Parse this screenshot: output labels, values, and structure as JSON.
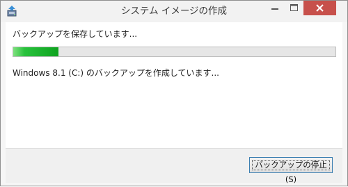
{
  "window": {
    "title": "システム イメージの作成",
    "icon": "system-image-backup-icon"
  },
  "titlebar_controls": {
    "minimize_icon": "minimize-icon",
    "maximize_icon": "maximize-icon",
    "close_icon": "close-icon",
    "close_color": "#c7504b"
  },
  "main": {
    "status_text": "バックアップを保存しています...",
    "progress_fraction": 0.14,
    "progress_color": "#1fb02e",
    "detail_text": "Windows 8.1 (C:) のバックアップを作成しています..."
  },
  "footer": {
    "stop_button_label": "バックアップの停止(S)"
  }
}
